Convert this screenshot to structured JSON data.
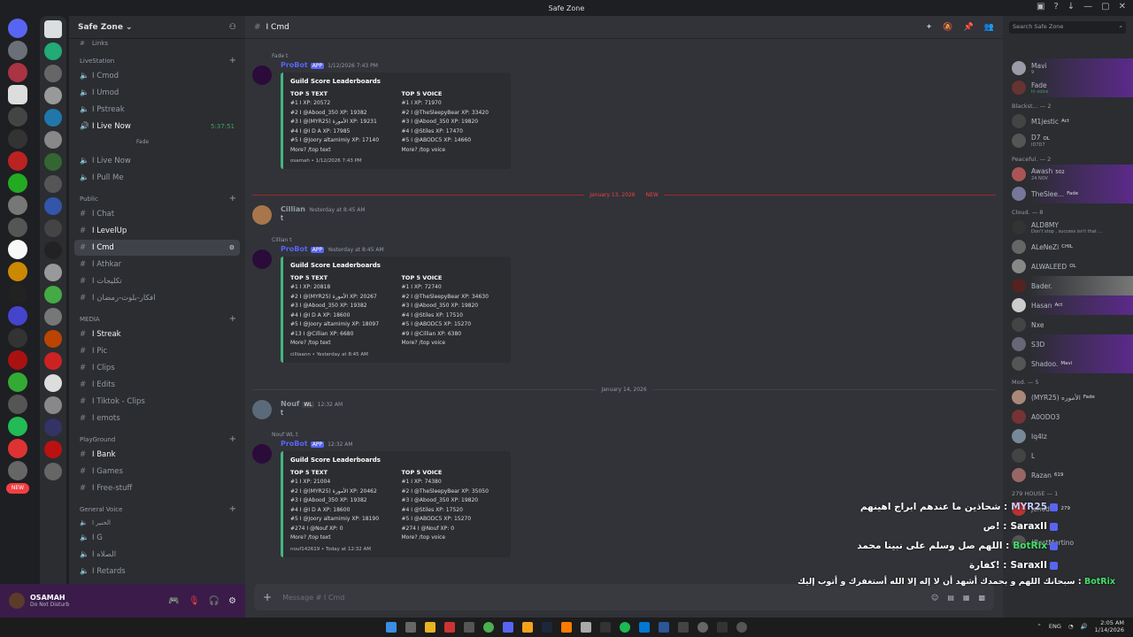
{
  "window": {
    "title": "Safe Zone"
  },
  "guild": {
    "name": "Safe Zone"
  },
  "categories": {
    "livestation": "LiveStation",
    "public": "Public",
    "media": "MEDIA",
    "playground": "PlayGround",
    "general_voice": "General Voice"
  },
  "channels": {
    "links": "Links",
    "livestation": [
      "I Cmod",
      "I Umod",
      "I Pstreak",
      "I Live Now"
    ],
    "live_time": "5:37:51",
    "voice_user": "Fade",
    "voice2": [
      "I Live Now",
      "I Pull Me"
    ],
    "public": [
      "I Chat",
      "I LevelUp",
      "I Cmd",
      "I Athkar",
      "I تكليجات",
      "I افكار-بلوت-رمضان"
    ],
    "media": [
      "I Streak",
      "I Pic",
      "I Clips",
      "I Edits",
      "I Tiktok - Clips",
      "I emots"
    ],
    "playground": [
      "I Bank",
      "I Games",
      "I Free-stuff"
    ],
    "general_voice": [
      "I الحنير",
      "I G",
      "I الصلاه",
      "I Retards"
    ]
  },
  "user": {
    "name": "OSAMAH",
    "status": "Do Not Disturb",
    "badge": "NEW"
  },
  "header": {
    "channel": "I Cmd",
    "search_placeholder": "Search Safe Zone"
  },
  "messages": [
    {
      "reply": "Fade  t",
      "author": "ProBot",
      "app": "APP",
      "time": "1/12/2026 7:43 PM",
      "embed_title": "Guild Score Leaderboards",
      "text_head": "TOP 5 TEXT",
      "voice_head": "TOP 5 VOICE",
      "text_rows": [
        "#1 I          XP: 20572",
        "#2 I @Abood_350 XP: 19382",
        "#3 I @(MYR25) الأمورة XP: 19231",
        "#4 I @I D A XP: 17985",
        "#5 I @Joory altamimiy XP: 17140"
      ],
      "voice_rows": [
        "#1 I          XP: 71970",
        "#2 I @TheSleepyBear XP: 33420",
        "#3 I @Abood_350 XP: 19820",
        "#4 I @Stiles XP: 17470",
        "#5 I @ABODC5 XP: 14660"
      ],
      "more": "More? /top text",
      "more_v": "More? /top voice",
      "footer": "osamah • 1/12/2026 7:43 PM"
    },
    {
      "author": "Cillian",
      "time": "Yesterday at 8:45 AM",
      "text": "t"
    },
    {
      "reply": "Cillian  t",
      "author": "ProBot",
      "app": "APP",
      "time": "Yesterday at 8:45 AM",
      "embed_title": "Guild Score Leaderboards",
      "text_head": "TOP 5 TEXT",
      "voice_head": "TOP 5 VOICE",
      "text_rows": [
        "#1 I          XP: 20818",
        "#2 I @(MYR25) الأمورة XP: 20267",
        "#3 I @Abood_350 XP: 19382",
        "#4 I @I D A XP: 18600",
        "#5 I @Joory altamimiy XP: 18097",
        "#13 I @Cillian XP: 6680"
      ],
      "voice_rows": [
        "#1 I          XP: 72740",
        "#2 I @TheSleepyBear XP: 34630",
        "#3 I @Abood_350 XP: 19820",
        "#4 I @Stiles XP: 17510",
        "#5 I @ABODC5 XP: 15270",
        "#9 I @Cillian XP: 6380"
      ],
      "more": "More? /top text",
      "more_v": "More? /top voice",
      "footer": "cilliaann • Yesterday at 8:45 AM"
    },
    {
      "author": "Nouf",
      "tag": "WL",
      "time": "12:32 AM",
      "text": "t"
    },
    {
      "reply": "Nouf  WL  t",
      "author": "ProBot",
      "app": "APP",
      "time": "12:32 AM",
      "embed_title": "Guild Score Leaderboards",
      "text_head": "TOP 5 TEXT",
      "voice_head": "TOP 5 VOICE",
      "text_rows": [
        "#1 I          XP: 21004",
        "#2 I @(MYR25) الأمورة XP: 20462",
        "#3 I @Abood_350 XP: 19382",
        "#4 I @I D A XP: 18600",
        "#5 I @Joory altamimiy XP: 18190",
        "#274 I @Nouf XP: 0"
      ],
      "voice_rows": [
        "#1 I          XP: 74380",
        "#2 I @TheSleepyBear XP: 35050",
        "#3 I @Abood_350 XP: 19820",
        "#4 I @Stiles XP: 17520",
        "#5 I @ABODC5 XP: 15270",
        "#274 I @Nouf XP: 0"
      ],
      "more": "More? /top text",
      "more_v": "More? /top voice",
      "footer": "nouf142619 • Today at 12:32 AM"
    }
  ],
  "dividers": {
    "d1": "January 13, 2026",
    "d2": "January 14, 2026",
    "new": "NEW"
  },
  "composer": {
    "placeholder": "Message #  I Cmd"
  },
  "members": {
    "top": [
      {
        "name": "Mavi",
        "status": "9"
      },
      {
        "name": "Fade",
        "status": "In voice"
      }
    ],
    "blackstar": "Blackst... — 2",
    "blackstar_list": [
      {
        "name": "M1jestic",
        "tag": "Act"
      },
      {
        "name": "D7",
        "tag": "OL",
        "status": "ID7D7"
      }
    ],
    "peaceful": "Peaceful. — 2",
    "peaceful_list": [
      {
        "name": "Awash",
        "tag": "502",
        "status": "24 NOV"
      },
      {
        "name": "TheSlee...",
        "tag": "Fade"
      }
    ],
    "cloud": "Cloud. — 8",
    "cloud_list": [
      {
        "name": "ALD8MY",
        "status": "Don't stop , success isn't that ..."
      },
      {
        "name": "ALeNeZi",
        "tag": "CHIL"
      },
      {
        "name": "ALWALEED",
        "tag": "OL"
      },
      {
        "name": "Bader."
      },
      {
        "name": "Hasan",
        "tag": "Act"
      },
      {
        "name": "Nxe"
      },
      {
        "name": "S3D"
      },
      {
        "name": "Shadoo.",
        "tag": "Mavi"
      }
    ],
    "mod": "Mod. — 5",
    "mod_list": [
      {
        "name": "(MYR25) الأموره",
        "tag": "Fade"
      },
      {
        "name": "A0ODO3"
      },
      {
        "name": "Iq4lz"
      },
      {
        "name": "L"
      },
      {
        "name": "Razan",
        "tag": "619"
      }
    ],
    "house": "279 HOUSE — 1",
    "house_list": [
      {
        "name": "Jehod79",
        "tag": "279"
      }
    ],
    "aura": "Aura. — 1",
    "aura_list": [
      {
        "name": "!BestMartino"
      }
    ]
  },
  "overlay": [
    {
      "who": "MYR25",
      "text": "شحاذين ما عندهم ابراج اهينهم :"
    },
    {
      "who": "SaraxII",
      "text": "ص! :"
    },
    {
      "who": "BotRix",
      "text": "اللهم صل وسلم على نبينا محمد :"
    },
    {
      "who": "SaraxII",
      "text": "كفارة! :"
    },
    {
      "who": "BotRix",
      "text": "سبحانك اللهم و بحمدك أشهد أن لا إله إلا الله أستغفرك و أتوب إليك :"
    }
  ],
  "taskbar": {
    "lang": "ENG",
    "time": "2:05 AM",
    "date": "1/14/2026"
  }
}
